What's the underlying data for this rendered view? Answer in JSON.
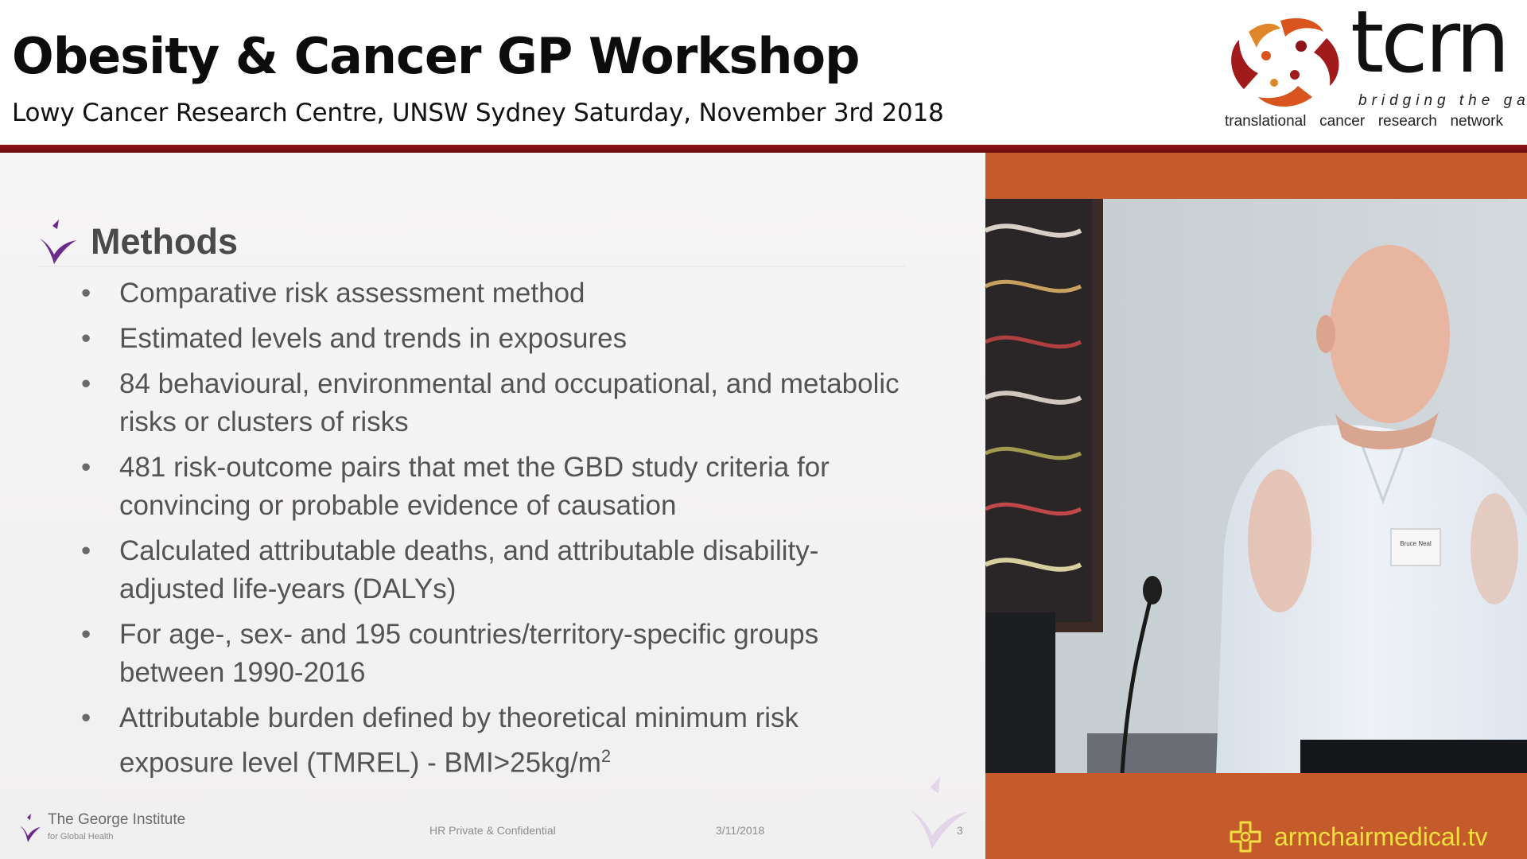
{
  "header": {
    "title": "Obesity & Cancer GP Workshop",
    "subtitle": "Lowy Cancer Research Centre, UNSW Sydney Saturday, November 3rd 2018",
    "logo": {
      "word": "tcrn",
      "tagline": "bridging the gap",
      "network_words": [
        "translational",
        "cancer",
        "research",
        "network"
      ]
    },
    "divider_color": "#7a1015"
  },
  "slide": {
    "heading": "Methods",
    "bullets": [
      "Comparative risk assessment method",
      "Estimated levels and trends in exposures",
      "84 behavioural, environmental and occupational, and metabolic risks or clusters of risks",
      "481 risk-outcome pairs that met the GBD study criteria for convincing or probable evidence of causation",
      "Calculated attributable deaths, and attributable disability-adjusted life-years (DALYs)",
      "For age-, sex- and 195 countries/territory-specific groups between 1990-2016",
      "Attributable burden defined by theoretical minimum risk exposure level (TMREL) - BMI>25kg/m"
    ],
    "last_bullet_superscript": "2",
    "footer": {
      "institute": "The George Institute",
      "institute_sub": "for Global Health",
      "confidential": "HR Private & Confidential",
      "date": "3/11/2018",
      "page": "3"
    },
    "accent_color": "#6b2a8a"
  },
  "video": {
    "badge_text": "Bruce Neal"
  },
  "brand": {
    "name": "armchairmedical.tv",
    "icon": "medical-cross-icon",
    "color": "#f0e040",
    "panel_color": "#c55b2a"
  }
}
